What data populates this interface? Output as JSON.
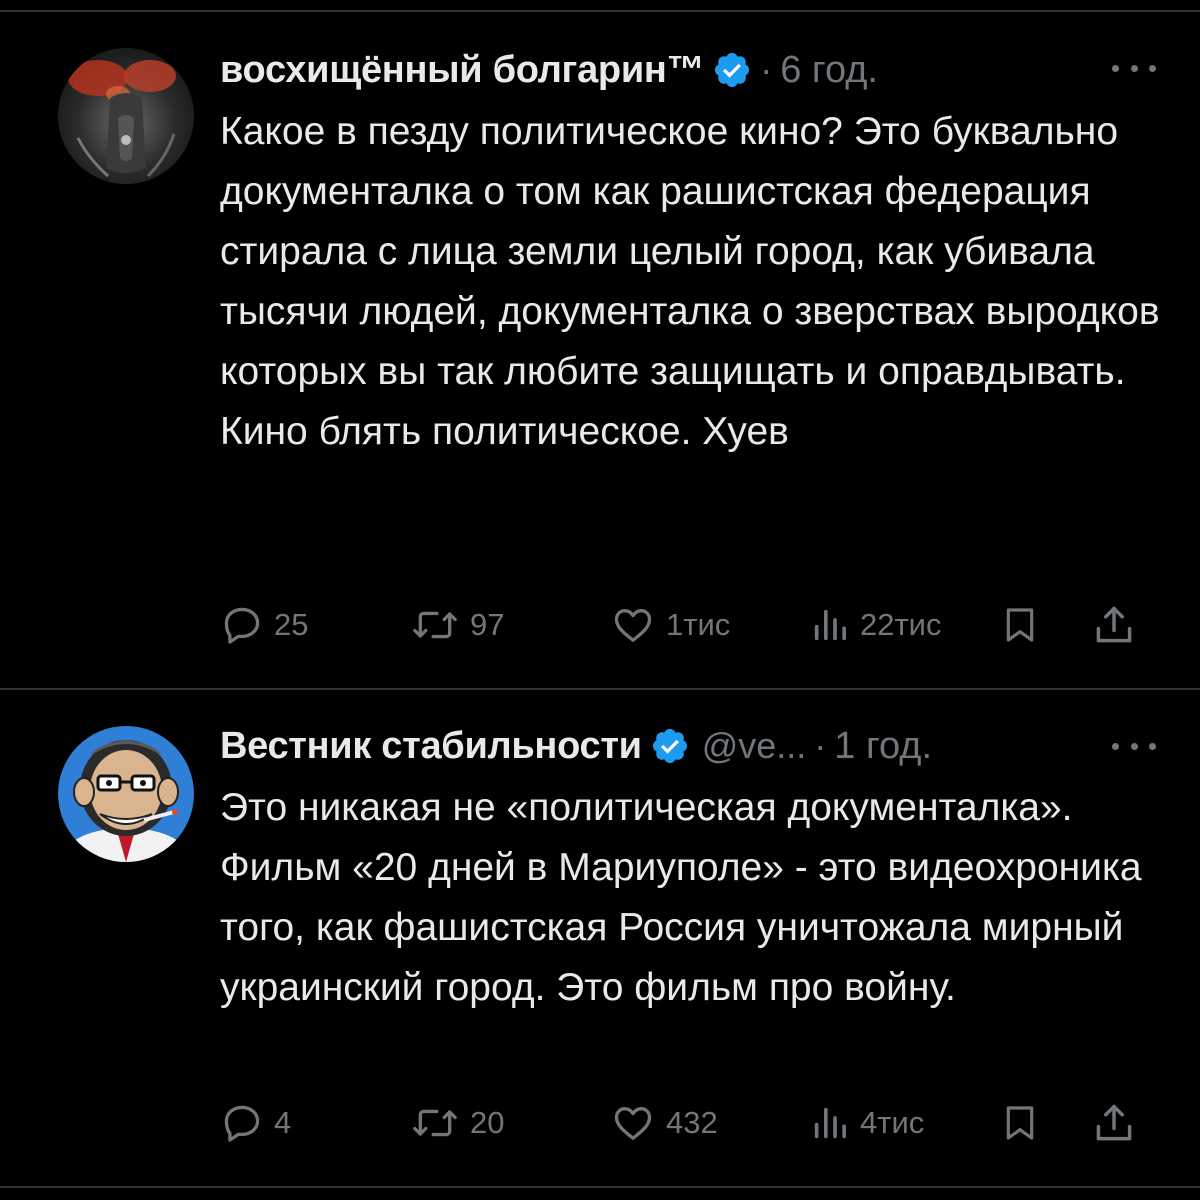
{
  "tweets": [
    {
      "author": "восхищённый болгарин™",
      "handle": "",
      "separator": "·",
      "time": "6 год.",
      "text": "Какое в пезду политическое кино? Это буквально документалка о том как рашистская федерация стирала с лица земли целый город, как убивала тысячи людей, документалка о зверствах выродков которых вы так любите защищать и оправдывать. Кино блять политическое. Хуев",
      "stats": {
        "replies": "25",
        "reposts": "97",
        "likes": "1тис",
        "views": "22тис"
      }
    },
    {
      "author": "Вестник стабильности",
      "handle": "@ve...",
      "separator": "·",
      "time": "1 год.",
      "text": "Это никакая не «политическая документалка». Фильм «20 дней в Мариуполе» - это видеохроника того, как фашистская Россия уничтожала мирный украинский город. Это фильм про войну.",
      "stats": {
        "replies": "4",
        "reposts": "20",
        "likes": "432",
        "views": "4тис"
      }
    }
  ],
  "colors": {
    "background": "#000000",
    "text": "#e7e9ea",
    "muted": "#71767b",
    "verified": "#1d9bf0",
    "divider": "#2f3336"
  },
  "icons": [
    "verified-badge-icon",
    "more-icon",
    "reply-icon",
    "repost-icon",
    "like-icon",
    "views-icon",
    "bookmark-icon",
    "share-icon"
  ]
}
